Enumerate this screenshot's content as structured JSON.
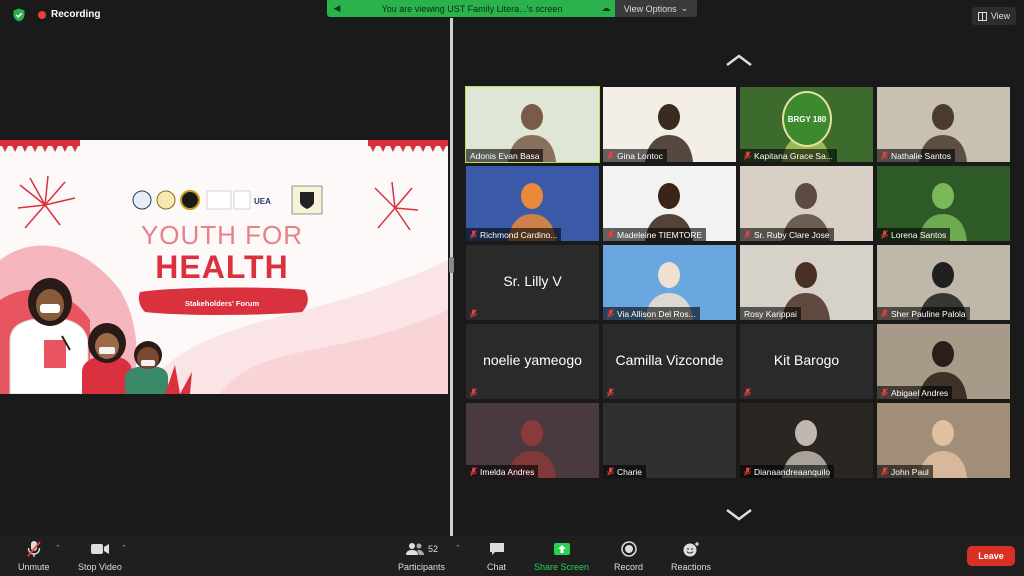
{
  "topbar": {
    "recording_label": "Recording",
    "share_banner_text": "You are viewing UST Family Litera...'s screen",
    "view_options_label": "View Options",
    "view_label": "View"
  },
  "shared_screen": {
    "title_line1": "YOUTH FOR",
    "title_line2": "HEALTH",
    "subtitle": "Stakeholders' Forum",
    "logo_text": "UEA"
  },
  "participants": [
    {
      "name": "Adonis Evan Basa",
      "muted": false,
      "video": true,
      "active": true
    },
    {
      "name": "Gina Lontoc",
      "muted": true,
      "video": true
    },
    {
      "name": "Kapitana Grace Sa...",
      "muted": true,
      "video": true,
      "badge": "BRGY 180"
    },
    {
      "name": "Nathalie Santos",
      "muted": true,
      "video": true
    },
    {
      "name": "Richmond Cardino...",
      "muted": true,
      "video": true
    },
    {
      "name": "Madeleine TIEMTORE",
      "muted": true,
      "video": true
    },
    {
      "name": "Sr.  Ruby Clare Jose",
      "muted": true,
      "video": true
    },
    {
      "name": "Lorena Santos",
      "muted": true,
      "video": true
    },
    {
      "name": "Sr. Lilly V",
      "muted": true,
      "video": false
    },
    {
      "name": "Via Allison Del Ros...",
      "muted": true,
      "video": true
    },
    {
      "name": "Rosy Karippai",
      "muted": false,
      "video": true
    },
    {
      "name": "Sher Pauline Palola",
      "muted": true,
      "video": true
    },
    {
      "name": "noelie yameogo",
      "muted": true,
      "video": false
    },
    {
      "name": "Camilla Vizconde",
      "muted": true,
      "video": false
    },
    {
      "name": "Kit Barogo",
      "muted": true,
      "video": false
    },
    {
      "name": "Abigael Andres",
      "muted": true,
      "video": true
    },
    {
      "name": "Imelda Andres",
      "muted": true,
      "video": true
    },
    {
      "name": "Charie",
      "muted": true,
      "video": true
    },
    {
      "name": "Dianaandreaanquilo",
      "muted": true,
      "video": true
    },
    {
      "name": "John Paul",
      "muted": true,
      "video": true
    }
  ],
  "toolbar": {
    "unmute": "Unmute",
    "stop_video": "Stop Video",
    "participants": "Participants",
    "participants_count": "52",
    "chat": "Chat",
    "share_screen": "Share Screen",
    "record": "Record",
    "reactions": "Reactions",
    "leave": "Leave"
  },
  "colors": {
    "accent_green": "#2bb24c",
    "leave_red": "#d93025",
    "active_speaker": "#b8e05a",
    "muted_red": "#e8403c"
  }
}
